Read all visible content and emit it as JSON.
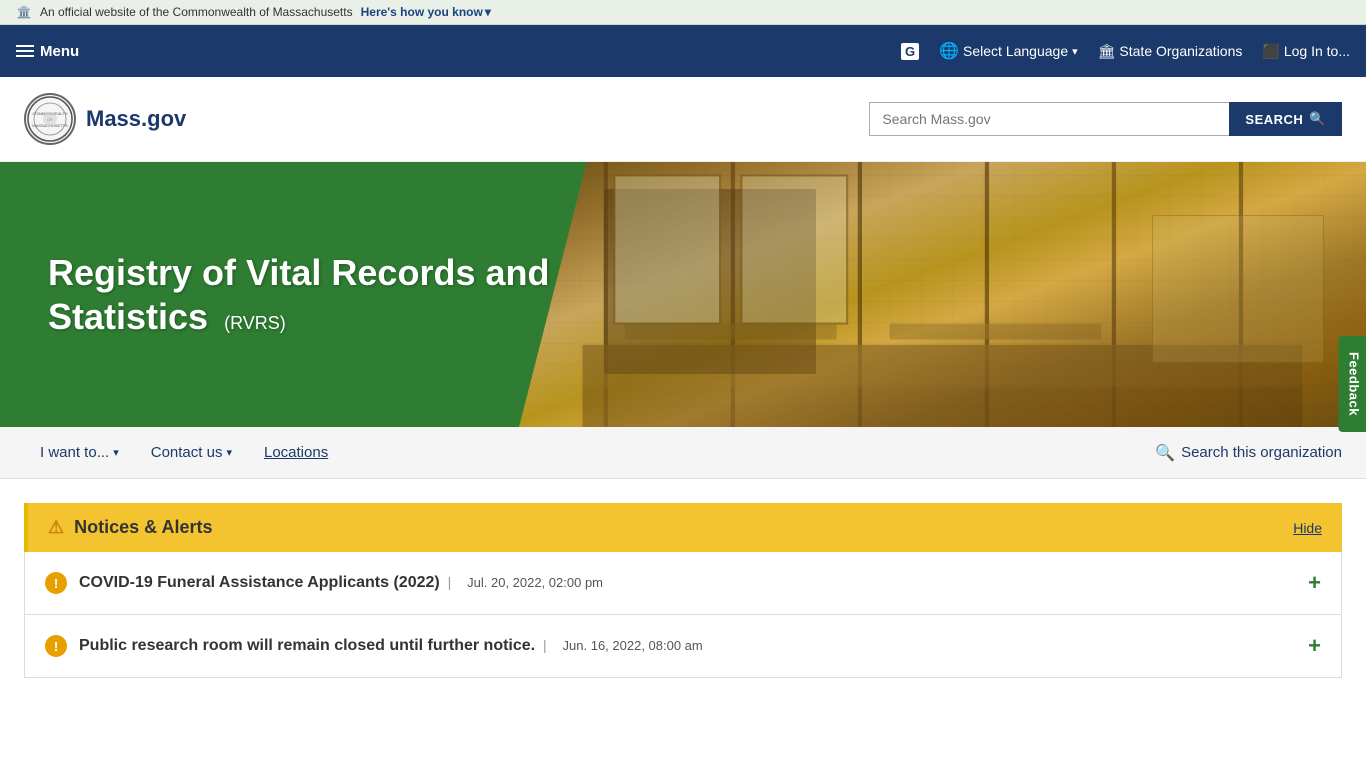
{
  "topBanner": {
    "officialText": "An official website of the Commonwealth of Massachusetts",
    "heresHowText": "Here's how you know",
    "chevron": "▾"
  },
  "mainNav": {
    "menuLabel": "Menu",
    "googleIconLabel": "G",
    "selectLanguageLabel": "Select Language",
    "stateOrgsLabel": "State Organizations",
    "loginLabel": "Log In to..."
  },
  "searchHeader": {
    "logoText": "Mass.gov",
    "sealLabel": "Massachusetts State Seal",
    "searchPlaceholder": "Search Mass.gov",
    "searchButtonLabel": "SEARCH"
  },
  "hero": {
    "title": "Registry of Vital Records and Statistics",
    "acronym": "(RVRS)"
  },
  "subNav": {
    "iwantto": "I want to...",
    "contactus": "Contact us",
    "locations": "Locations",
    "searchOrg": "Search this organization"
  },
  "notices": {
    "headerTitle": "Notices & Alerts",
    "hideLabel": "Hide",
    "items": [
      {
        "title": "COVID-19 Funeral Assistance Applicants (2022)",
        "date": "Jul. 20, 2022, 02:00 pm"
      },
      {
        "title": "Public research room will remain closed until further notice.",
        "date": "Jun. 16, 2022, 08:00 am"
      }
    ]
  },
  "feedback": {
    "label": "Feedback"
  }
}
